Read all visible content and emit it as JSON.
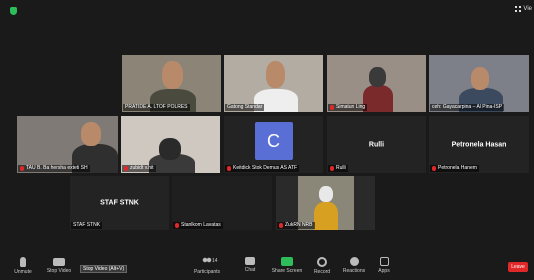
{
  "topbar": {
    "view_label": "Vie"
  },
  "tiles": [
    {
      "id": "t1",
      "name": "PRATIDE A. LTOF POLRES",
      "muted": false
    },
    {
      "id": "t2",
      "name": "Gatong Standar",
      "muted": false
    },
    {
      "id": "t3",
      "name": "Simatun Ling",
      "muted": true
    },
    {
      "id": "t4",
      "name": "ceh: Gayacarpina – Al Pina-ISP",
      "muted": false
    },
    {
      "id": "t5",
      "name": "TAU B. Ba hersha exteti SH",
      "muted": true
    },
    {
      "id": "t6",
      "name": "zubidt v.hit",
      "muted": true
    },
    {
      "id": "t7",
      "name": "Keitdick Stok Demus AS ATF",
      "muted": true,
      "avatar": "C"
    },
    {
      "id": "t8",
      "name": "Rulli",
      "muted": true,
      "center": "Rulli"
    },
    {
      "id": "t9",
      "name": "Petronela Hanem",
      "muted": true,
      "center": "Petronela Hasan"
    },
    {
      "id": "t10",
      "name": "STAF STNK",
      "muted": false,
      "center": "STAF STNK"
    },
    {
      "id": "t11",
      "name": "Stanlkom Lavatas",
      "muted": true
    },
    {
      "id": "t12",
      "name": "ZukRN NRB",
      "muted": true
    }
  ],
  "toolbar": {
    "unmute": "Unmute",
    "stop_video": "Stop Video",
    "participants": "Participants",
    "participants_count": "14",
    "chat": "Chat",
    "share_screen": "Share Screen",
    "record": "Record",
    "reactions": "Reactions",
    "apps": "Apps",
    "leave": "Leave",
    "tooltip": "Stop Video (Alt+V)"
  },
  "colors": {
    "accent_green": "#2dbd5a",
    "leave_red": "#e02828",
    "avatar_blue": "#5a6fd6"
  }
}
